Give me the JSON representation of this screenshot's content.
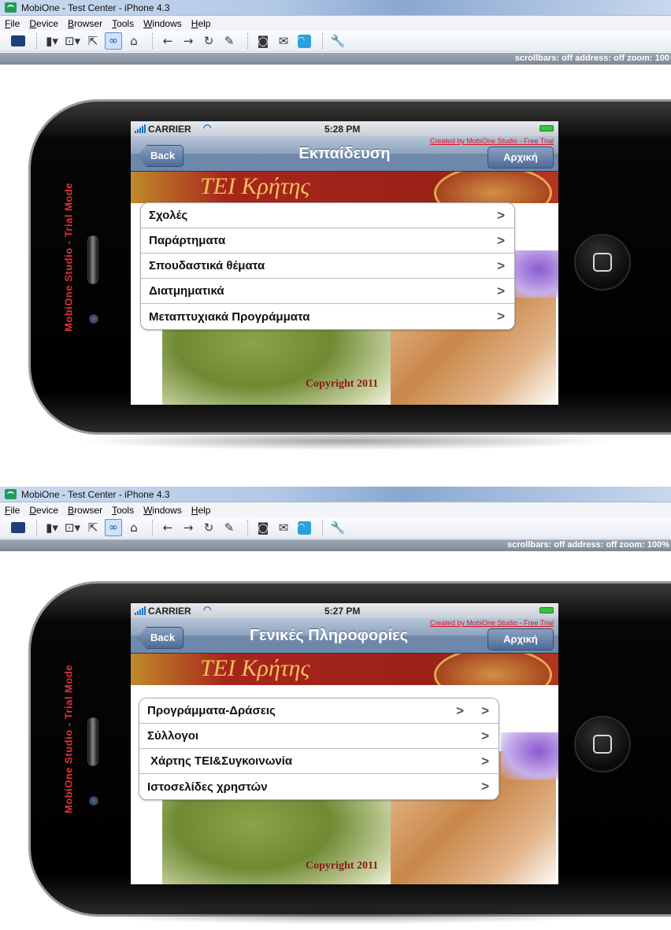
{
  "window": {
    "title": "MobiOne - Test Center - iPhone 4.3",
    "menu": [
      "File",
      "Device",
      "Browser",
      "Tools",
      "Windows",
      "Help"
    ],
    "status_text": "scrollbars: off   address: off   zoom: 100%",
    "status_text_top": "scrollbars: off   address: off   zoom: 100"
  },
  "device": {
    "trial_mode_text": "MobiOne Studio - Trial Mode",
    "carrier": "CARRIER",
    "trial_credit": "Created by MobiOne Studio - Free Trial",
    "back_label": "Back",
    "home_label": "Αρχική",
    "banner_title": "ΤΕΙ Κρήτης",
    "copyright": "Copyright 2011"
  },
  "screen1": {
    "time": "5:28 PM",
    "nav_title": "Εκπαίδευση",
    "items": [
      {
        "label": "Σχολές"
      },
      {
        "label": "Παράρτηματα"
      },
      {
        "label": "Σπουδαστικά θέματα"
      },
      {
        "label": "Διατμηματικά"
      },
      {
        "label": "Μεταπτυχιακά Προγράμματα"
      }
    ]
  },
  "screen2": {
    "time": "5:27 PM",
    "nav_title": "Γενικές Πληροφορίες",
    "items": [
      {
        "label": "Προγράμματα-Δράσεις"
      },
      {
        "label": "Σύλλογοι"
      },
      {
        "label": "Χάρτης ΤΕΙ&Συγκοινωνία"
      },
      {
        "label": "Ιστοσελίδες χρηστών"
      }
    ]
  },
  "icons": {
    "chevron": ">"
  }
}
